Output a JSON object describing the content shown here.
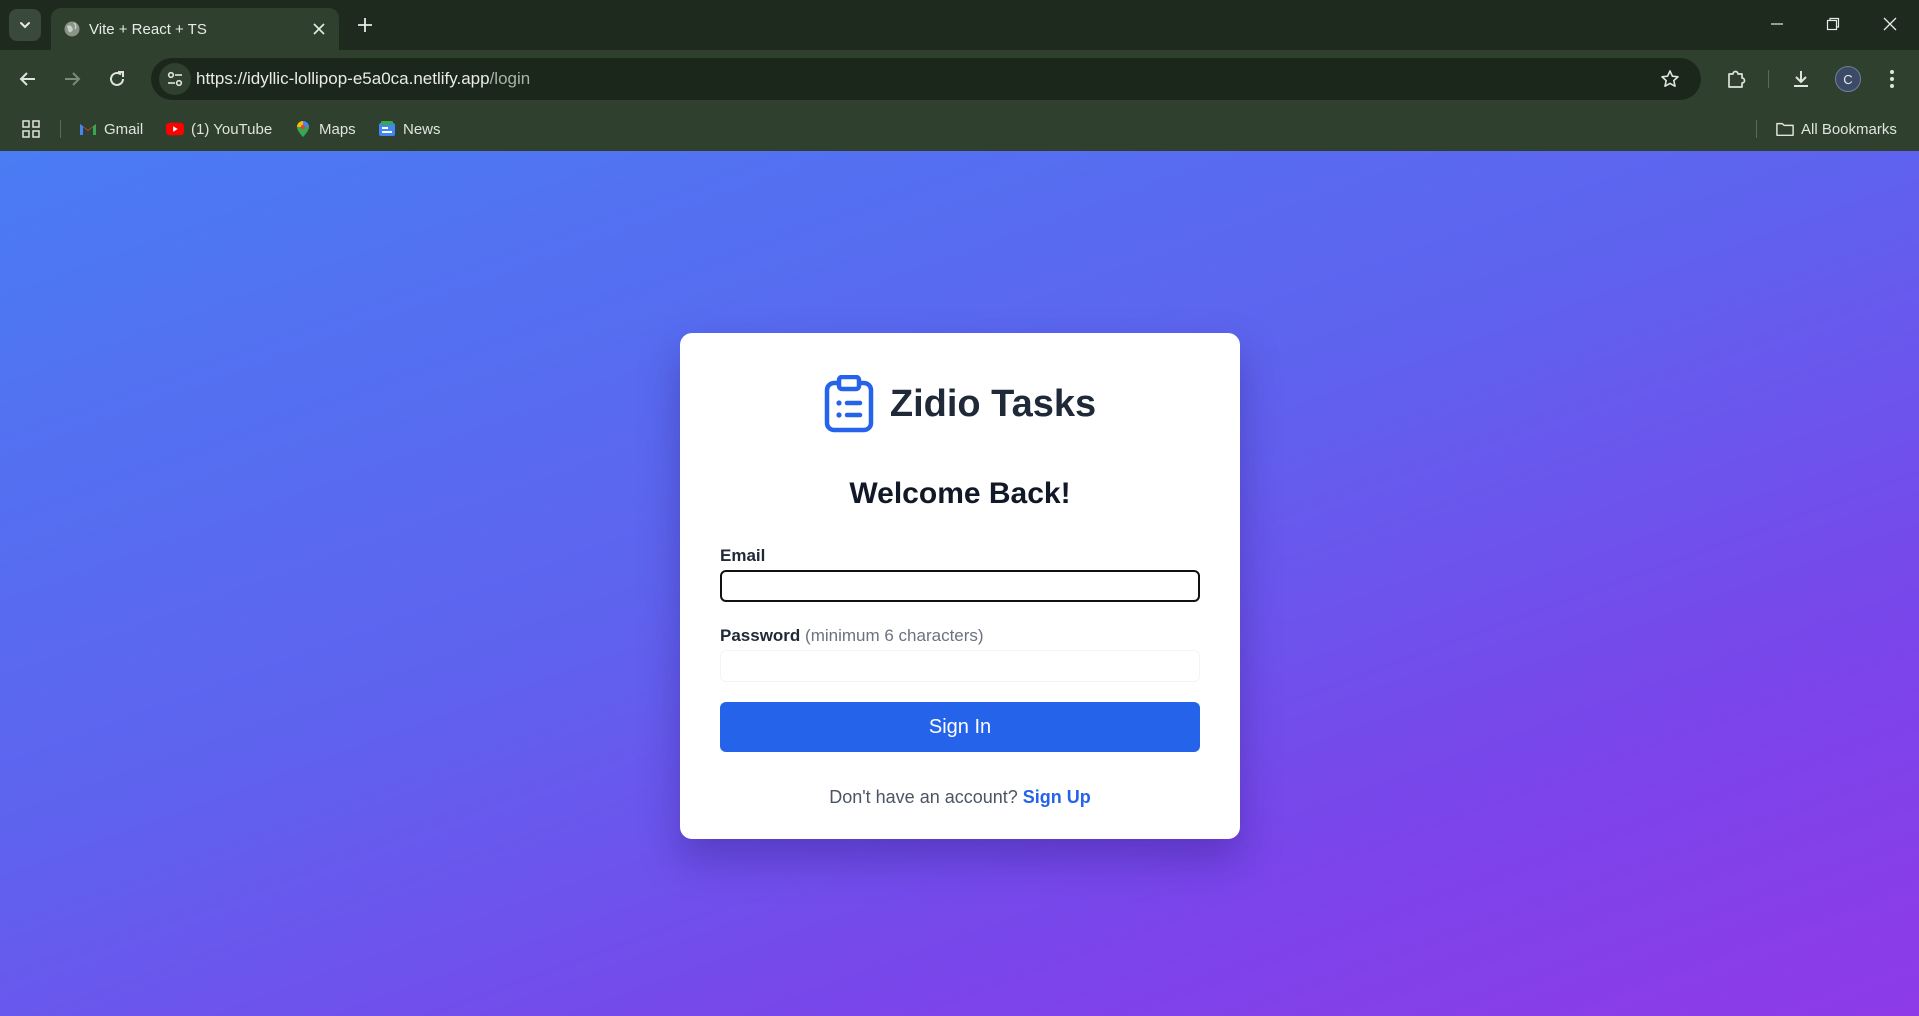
{
  "browser": {
    "tab_title": "Vite + React + TS",
    "url_host": "https://idyllic-lollipop-e5a0ca.netlify.app",
    "url_path": "/login",
    "profile_initial": "C",
    "bookmarks": [
      {
        "label": "Gmail",
        "icon": "gmail-icon"
      },
      {
        "label": "(1) YouTube",
        "icon": "youtube-icon"
      },
      {
        "label": "Maps",
        "icon": "maps-icon"
      },
      {
        "label": "News",
        "icon": "news-icon"
      }
    ],
    "all_bookmarks_label": "All Bookmarks",
    "colors": {
      "tabstrip": "#1d2a1d",
      "toolbar": "#2f402f"
    }
  },
  "app": {
    "brand_name": "Zidio Tasks",
    "heading": "Welcome Back!",
    "email_label": "Email",
    "email_value": "",
    "password_label": "Password",
    "password_hint": "(minimum 6 characters)",
    "password_value": "",
    "submit_label": "Sign In",
    "signup_prompt": "Don't have an account?",
    "signup_link": "Sign Up",
    "colors": {
      "accent": "#2563eb",
      "gradient_start": "#4a7cf4",
      "gradient_end": "#8e3ae8"
    }
  }
}
